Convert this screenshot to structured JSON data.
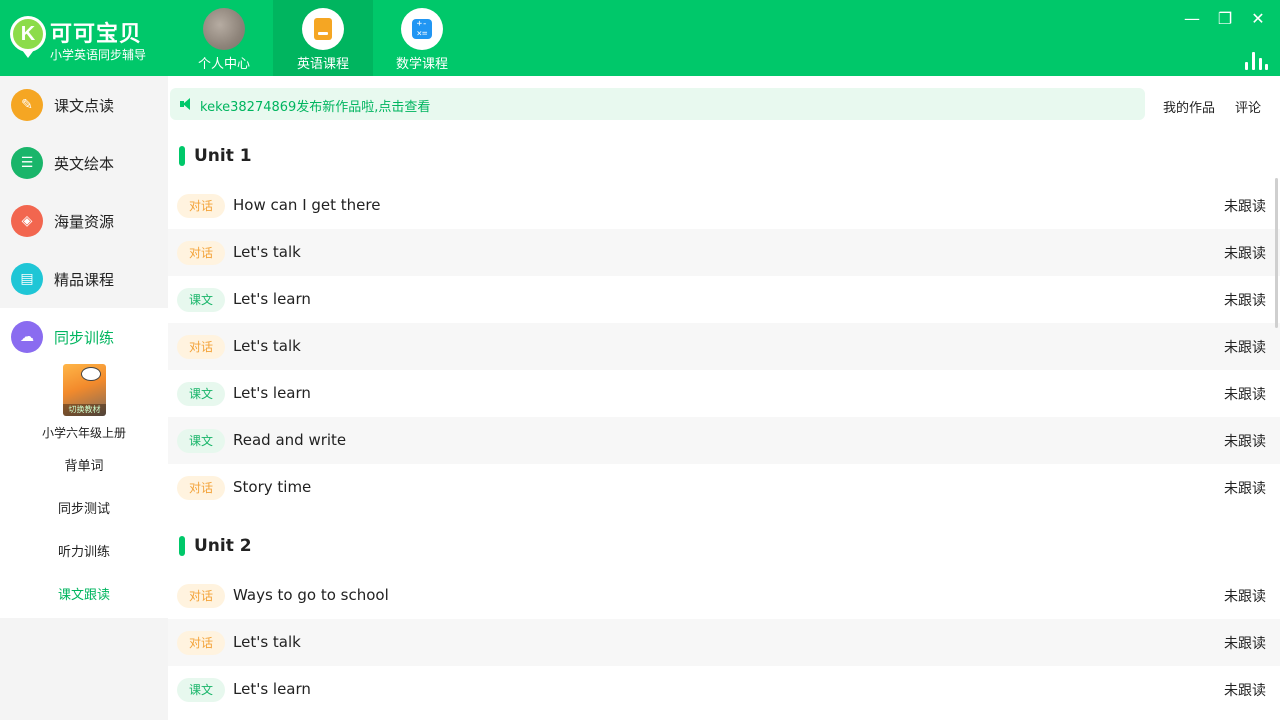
{
  "app": {
    "title": "可可宝贝",
    "subtitle": "小学英语同步辅导"
  },
  "nav": {
    "tabs": [
      {
        "label": "个人中心"
      },
      {
        "label": "英语课程"
      },
      {
        "label": "数学课程"
      }
    ],
    "active_index": 1
  },
  "window_controls": {
    "minimize": "—",
    "restore": "❐",
    "close": "✕"
  },
  "sidebar": {
    "items": [
      {
        "label": "课文点读",
        "icon": "read-icon",
        "color": "#f5a623"
      },
      {
        "label": "英文绘本",
        "icon": "book-icon",
        "color": "#19b56a"
      },
      {
        "label": "海量资源",
        "icon": "layers-icon",
        "color": "#f2664f"
      },
      {
        "label": "精品课程",
        "icon": "chat-icon",
        "color": "#1fc6d6"
      },
      {
        "label": "同步训练",
        "icon": "cloud-icon",
        "color": "#8a6cf0"
      }
    ],
    "active_index": 4,
    "textbook": {
      "switch_label": "切换教材",
      "grade": "小学六年级上册"
    },
    "sub_items": [
      {
        "label": "背单词"
      },
      {
        "label": "同步测试"
      },
      {
        "label": "听力训练"
      },
      {
        "label": "课文跟读"
      }
    ],
    "active_sub_index": 3
  },
  "notice": {
    "text": "keke38274869发布新作品啦,点击查看"
  },
  "top_links": {
    "my_works": "我的作品",
    "comments": "评论"
  },
  "units": [
    {
      "title": "Unit 1",
      "lessons": [
        {
          "tag": "对话",
          "type": "dialog",
          "title": "How can I get there",
          "status": "未跟读"
        },
        {
          "tag": "对话",
          "type": "dialog",
          "title": "Let's talk",
          "status": "未跟读"
        },
        {
          "tag": "课文",
          "type": "text",
          "title": "Let's learn",
          "status": "未跟读"
        },
        {
          "tag": "对话",
          "type": "dialog",
          "title": "Let's talk",
          "status": "未跟读"
        },
        {
          "tag": "课文",
          "type": "text",
          "title": "Let's learn",
          "status": "未跟读"
        },
        {
          "tag": "课文",
          "type": "text",
          "title": "Read and write",
          "status": "未跟读"
        },
        {
          "tag": "对话",
          "type": "dialog",
          "title": "Story time",
          "status": "未跟读"
        }
      ]
    },
    {
      "title": "Unit 2",
      "lessons": [
        {
          "tag": "对话",
          "type": "dialog",
          "title": "Ways to go to school",
          "status": "未跟读"
        },
        {
          "tag": "对话",
          "type": "dialog",
          "title": "Let's talk",
          "status": "未跟读"
        },
        {
          "tag": "课文",
          "type": "text",
          "title": "Let's learn",
          "status": "未跟读"
        }
      ]
    }
  ]
}
